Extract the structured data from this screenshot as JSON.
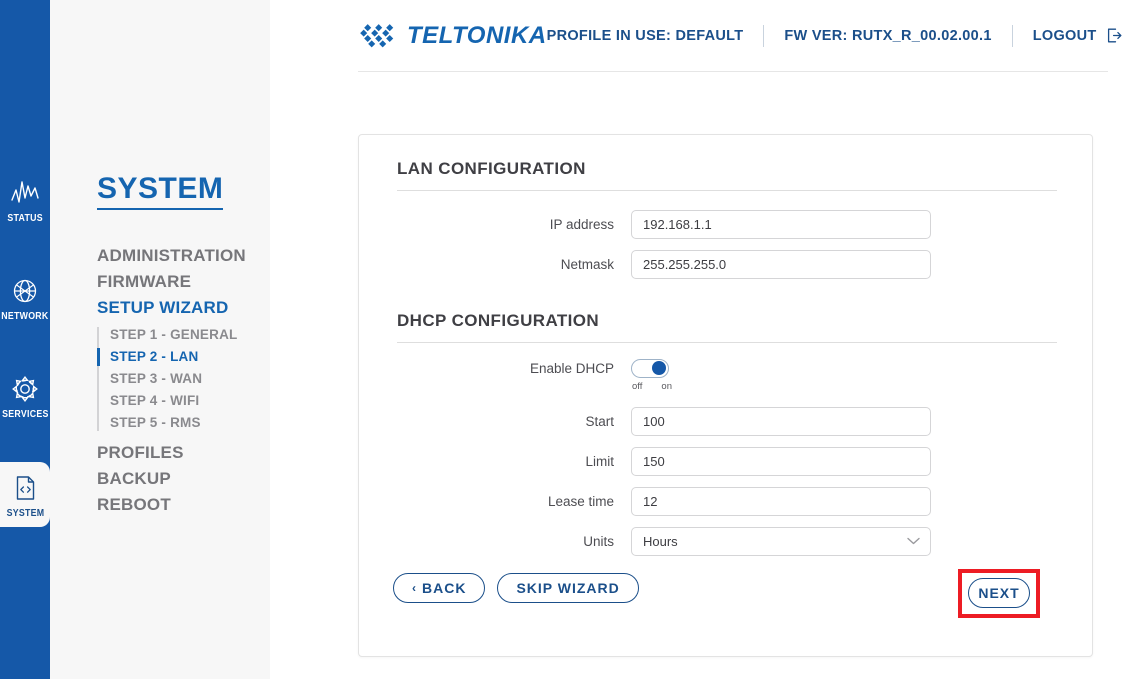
{
  "rail": {
    "items": [
      {
        "label": "STATUS",
        "icon": "pulse-icon",
        "active": false
      },
      {
        "label": "NETWORK",
        "icon": "globe-icon",
        "active": false
      },
      {
        "label": "SERVICES",
        "icon": "gear-icon",
        "active": false
      },
      {
        "label": "SYSTEM",
        "icon": "code-file-icon",
        "active": true
      }
    ]
  },
  "sidebar": {
    "title": "SYSTEM",
    "items": [
      {
        "label": "ADMINISTRATION",
        "active": false
      },
      {
        "label": "FIRMWARE",
        "active": false
      },
      {
        "label": "SETUP WIZARD",
        "active": true
      },
      {
        "label": "PROFILES",
        "active": false
      },
      {
        "label": "BACKUP",
        "active": false
      },
      {
        "label": "REBOOT",
        "active": false
      }
    ],
    "substeps": [
      {
        "label": "STEP 1 - GENERAL",
        "active": false
      },
      {
        "label": "STEP 2 - LAN",
        "active": true
      },
      {
        "label": "STEP 3 - WAN",
        "active": false
      },
      {
        "label": "STEP 4 - WIFI",
        "active": false
      },
      {
        "label": "STEP 5 - RMS",
        "active": false
      }
    ]
  },
  "header": {
    "logo_text": "TELTONIKA",
    "profile_in_use": "PROFILE IN USE: DEFAULT",
    "fw_version": "FW VER: RUTX_R_00.02.00.1",
    "logout": "LOGOUT",
    "logout_icon": "logout-icon"
  },
  "lan": {
    "section_title": "LAN CONFIGURATION",
    "ip_label": "IP address",
    "ip_value": "192.168.1.1",
    "netmask_label": "Netmask",
    "netmask_value": "255.255.255.0"
  },
  "dhcp": {
    "section_title": "DHCP CONFIGURATION",
    "enable_label": "Enable DHCP",
    "enable_state": "on",
    "toggle_off_label": "off",
    "toggle_on_label": "on",
    "start_label": "Start",
    "start_value": "100",
    "limit_label": "Limit",
    "limit_value": "150",
    "lease_label": "Lease time",
    "lease_value": "12",
    "units_label": "Units",
    "units_value": "Hours"
  },
  "footer": {
    "back_label": "BACK",
    "back_arrow": "‹",
    "skip_label": "SKIP WIZARD",
    "next_label": "NEXT"
  },
  "colors": {
    "brand_blue": "#1558a8",
    "link_blue": "#1565b0",
    "dark_blue": "#1b4f8a",
    "highlight_red": "#ed1c24",
    "sidebar_bg": "#f7f7f7"
  }
}
